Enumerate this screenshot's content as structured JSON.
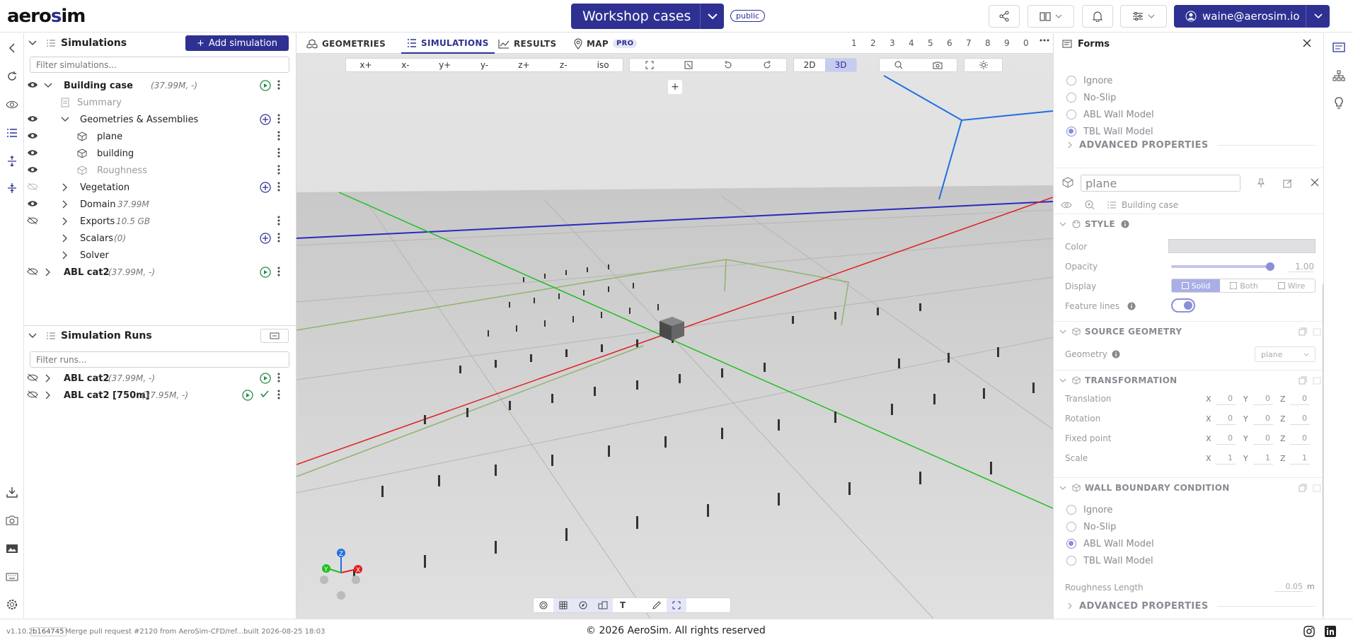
{
  "app": {
    "logo_left": "aero",
    "logo_accent": "s",
    "logo_right": "im"
  },
  "project": {
    "title": "Workshop cases",
    "visibility": "public"
  },
  "user": {
    "email": "waine@aerosim.io"
  },
  "sidebar_tree": {
    "header": "Simulations",
    "add_label": "Add simulation",
    "filter_placeholder": "Filter simulations...",
    "items": [
      {
        "label": "Building case",
        "meta": "(37.99M, -)"
      },
      {
        "label": "Summary"
      },
      {
        "label": "Geometries & Assemblies"
      },
      {
        "label": "plane"
      },
      {
        "label": "building"
      },
      {
        "label": "Roughness"
      },
      {
        "label": "Vegetation"
      },
      {
        "label": "Domain",
        "meta": "37.99M"
      },
      {
        "label": "Exports",
        "meta": "10.5 GB"
      },
      {
        "label": "Scalars",
        "meta": "(0)"
      },
      {
        "label": "Solver"
      },
      {
        "label": "ABL cat2",
        "meta": "(37.99M, -)"
      }
    ]
  },
  "runs": {
    "header": "Simulation Runs",
    "filter_placeholder": "Filter runs...",
    "items": [
      {
        "label": "ABL cat2",
        "meta": "(37.99M, -)"
      },
      {
        "label": "ABL cat2 [750m]",
        "meta": "(37.95M, -)"
      }
    ]
  },
  "tabs": [
    {
      "label": "GEOMETRIES"
    },
    {
      "label": "SIMULATIONS"
    },
    {
      "label": "RESULTS"
    },
    {
      "label": "MAP",
      "badge": "PRO"
    }
  ],
  "layer_numbers": [
    "1",
    "2",
    "3",
    "4",
    "5",
    "6",
    "7",
    "8",
    "9",
    "0"
  ],
  "view_buttons": [
    "x+",
    "x-",
    "y+",
    "y-",
    "z+",
    "z-",
    "iso"
  ],
  "dim_buttons": [
    "2D",
    "3D"
  ],
  "forms": {
    "title": "Forms",
    "top_options": [
      "Ignore",
      "No-Slip",
      "ABL Wall Model",
      "TBL Wall Model"
    ],
    "advanced": "ADVANCED PROPERTIES",
    "object_name": "plane",
    "breadcrumb": "Building case",
    "style_header": "STYLE",
    "color_label": "Color",
    "opacity_label": "Opacity",
    "opacity_value": "1.00",
    "display_label": "Display",
    "display_options": [
      "Solid",
      "Both",
      "Wire"
    ],
    "feature_lines_label": "Feature lines",
    "source_header": "SOURCE GEOMETRY",
    "geometry_label": "Geometry",
    "geometry_value": "plane",
    "transform_header": "TRANSFORMATION",
    "transform_rows": [
      {
        "label": "Translation",
        "x": "0",
        "y": "0",
        "z": "0"
      },
      {
        "label": "Rotation",
        "x": "0",
        "y": "0",
        "z": "0"
      },
      {
        "label": "Fixed point",
        "x": "0",
        "y": "0",
        "z": "0"
      },
      {
        "label": "Scale",
        "x": "1",
        "y": "1",
        "z": "1"
      }
    ],
    "axis_x": "X",
    "axis_y": "Y",
    "axis_z": "Z",
    "wall_header": "WALL BOUNDARY CONDITION",
    "wall_options": [
      "Ignore",
      "No-Slip",
      "ABL Wall Model",
      "TBL Wall Model"
    ],
    "roughness_label": "Roughness Length",
    "roughness_value": "0.05",
    "roughness_unit": "m"
  },
  "footer": {
    "version": "v1.10.2",
    "commit": "b164745",
    "message": "Merge pull request #2120 from AeroSim-CFD/ref...",
    "built": "built 2026-08-25 18:03",
    "copyright": "© 2026 AeroSim. All rights reserved"
  },
  "colors": {
    "accent": "#2e3192",
    "axis_x": "#e02020",
    "axis_y": "#20c020",
    "axis_z": "#1f6fe0"
  }
}
